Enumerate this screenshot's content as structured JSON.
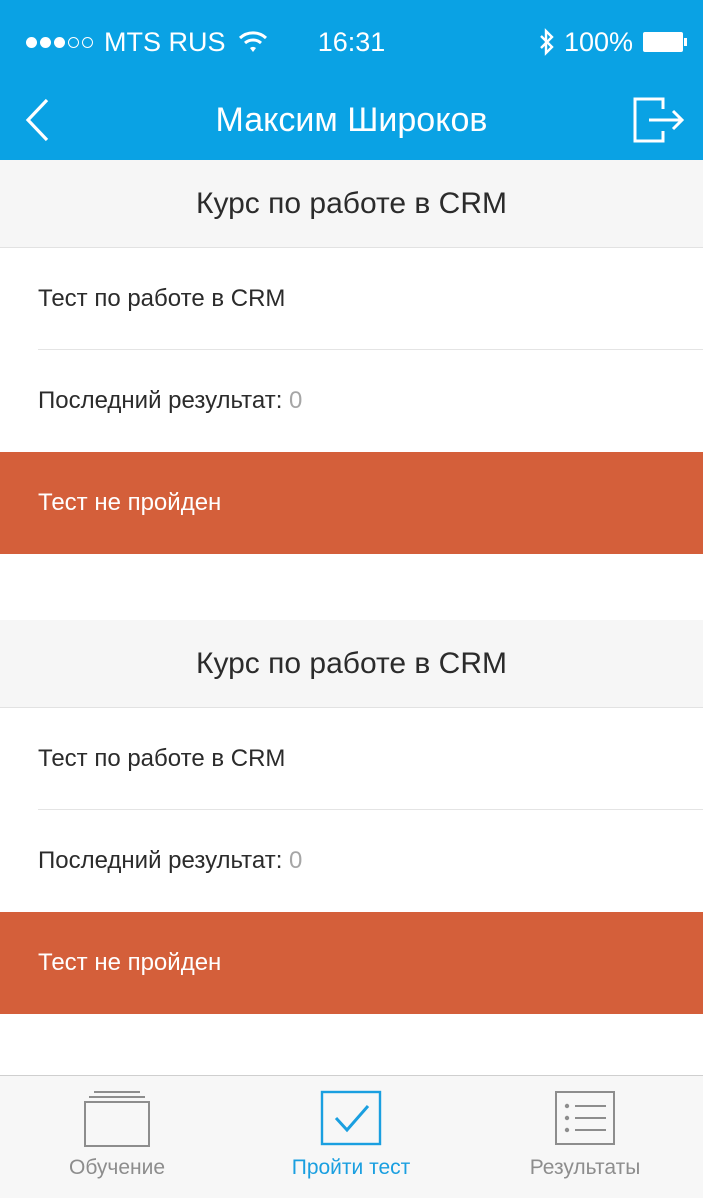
{
  "colors": {
    "accent": "#0aa2e4",
    "failed": "#d45f3a",
    "active_tab": "#1a9fe0",
    "inactive_tab": "#8d8d8d"
  },
  "status_bar": {
    "carrier": "MTS RUS",
    "time": "16:31",
    "battery": "100%",
    "signal_icon": "signal-dots-icon",
    "wifi_icon": "wifi-icon",
    "bluetooth_icon": "bluetooth-icon",
    "battery_icon": "battery-icon"
  },
  "nav": {
    "title": "Максим Широков",
    "back_icon": "chevron-left-icon",
    "logout_icon": "logout-icon"
  },
  "courses": [
    {
      "title": "Курс по работе в CRM",
      "test_name": "Тест по работе в CRM",
      "result_label": "Последний результат:",
      "result_value": "0",
      "status": "Тест не пройден"
    },
    {
      "title": "Курс по работе в CRM",
      "test_name": "Тест по работе в CRM",
      "result_label": "Последний результат:",
      "result_value": "0",
      "status": "Тест не пройден"
    }
  ],
  "tabs": [
    {
      "label": "Обучение",
      "icon": "folder-stack-icon",
      "active": false
    },
    {
      "label": "Пройти тест",
      "icon": "checkbox-icon",
      "active": true
    },
    {
      "label": "Результаты",
      "icon": "list-icon",
      "active": false
    }
  ]
}
